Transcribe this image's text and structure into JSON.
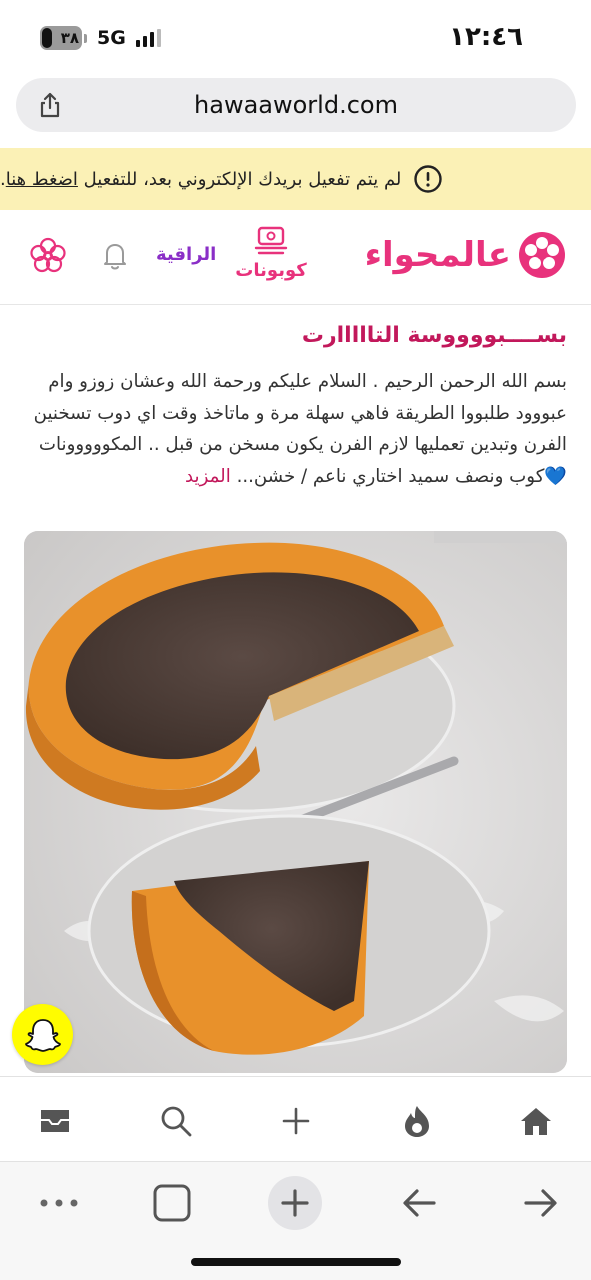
{
  "status_bar": {
    "time": "١٢:٤٦",
    "battery": "٣٨",
    "network": "5G"
  },
  "browser": {
    "url": "hawaaworld.com"
  },
  "notice": {
    "text": "لم يتم تفعيل بريدك الإلكتروني بعد، للتفعيل",
    "link_label": "اضغط هنا",
    "suffix": "."
  },
  "site_header": {
    "logo_text": "عالمحواء",
    "coupons_label": "كوبونات",
    "raqia_label": "الراقية",
    "brand_color": "#e8327c"
  },
  "article": {
    "title": "بســــبووووسة التااااارت",
    "body": "بسم الله الرحمن الرحيم . السلام عليكم ورحمة الله وعشان زوزو وام عبووود طلبووا الطريقة فاهي سهلة مرة و ماتاخذ وقت اي دوب تسخنين الفرن وتبدين تعمليها لازم الفرن يكون مسخن من قبل .. المكووووونات 💙كوب ونصف سميد اختاري ناعم / خشن...",
    "more_label": "المزيد"
  },
  "tab_bar": {
    "items": [
      "inbox-icon",
      "search-icon",
      "plus-icon",
      "fire-icon",
      "home-icon"
    ]
  },
  "nav_bar": {
    "items": [
      "more-icon",
      "tabs-icon",
      "new-tab-icon",
      "back-icon",
      "forward-icon"
    ]
  }
}
